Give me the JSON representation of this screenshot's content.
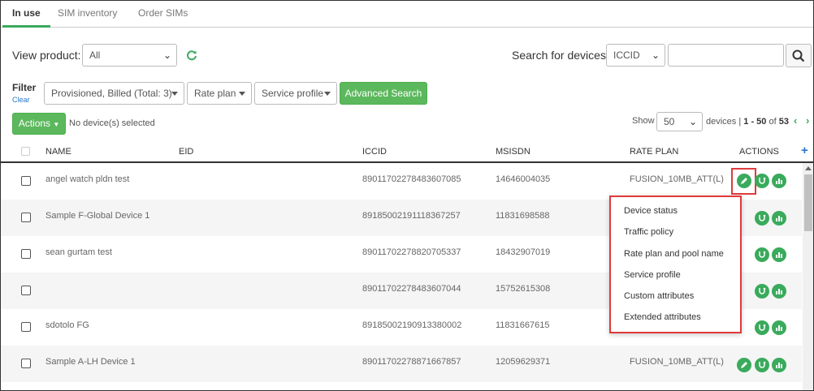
{
  "tabs": [
    "In use",
    "SIM inventory",
    "Order SIMs"
  ],
  "view_product": {
    "label": "View product:",
    "value": "All"
  },
  "search": {
    "label": "Search for devices",
    "field": "ICCID",
    "value": ""
  },
  "filter": {
    "title": "Filter",
    "clear": "Clear",
    "status": "Provisioned, Billed (Total: 3)",
    "rate_plan": "Rate plan",
    "service_profile": "Service profile",
    "advanced_search": "Advanced Search"
  },
  "actions_button": "Actions",
  "selection_text": "No device(s) selected",
  "pagination": {
    "show_label": "Show",
    "per_page": "50",
    "devices_label": "devices | ",
    "range": "1 - 50",
    "of_label": " of ",
    "total": "53"
  },
  "table": {
    "headers": {
      "name": "NAME",
      "eid": "EID",
      "iccid": "ICCID",
      "msisdn": "MSISDN",
      "rate_plan": "RATE PLAN",
      "actions": "ACTIONS"
    },
    "rows": [
      {
        "name": "angel watch pldn test",
        "eid": "",
        "iccid": "89011702278483607085",
        "msisdn": "14646004035",
        "rate_plan": "FUSION_10MB_ATT(L)"
      },
      {
        "name": "Sample F-Global Device 1",
        "eid": "",
        "iccid": "89185002191118367257",
        "msisdn": "11831698588",
        "rate_plan": ""
      },
      {
        "name": "sean gurtam test",
        "eid": "",
        "iccid": "89011702278820705337",
        "msisdn": "18432907019",
        "rate_plan": ""
      },
      {
        "name": "",
        "eid": "",
        "iccid": "89011702278483607044",
        "msisdn": "15752615308",
        "rate_plan": ""
      },
      {
        "name": "sdotolo FG",
        "eid": "",
        "iccid": "89185002190913380002",
        "msisdn": "11831667615",
        "rate_plan": ""
      },
      {
        "name": "Sample A-LH Device 1",
        "eid": "",
        "iccid": "89011702278871667857",
        "msisdn": "12059629371",
        "rate_plan": "FUSION_10MB_ATT(L)"
      }
    ]
  },
  "menu": [
    "Device status",
    "Traffic policy",
    "Rate plan and pool name",
    "Service profile",
    "Custom attributes",
    "Extended attributes"
  ],
  "icons": {
    "edit": "pencil-icon",
    "diagnose": "stethoscope-icon",
    "usage": "bar-chart-icon",
    "refresh": "refresh-icon",
    "search": "search-icon",
    "add": "plus-icon"
  },
  "colors": {
    "accent": "#3aaa5c",
    "highlight": "#e03a3a",
    "link": "#2a77c9"
  }
}
